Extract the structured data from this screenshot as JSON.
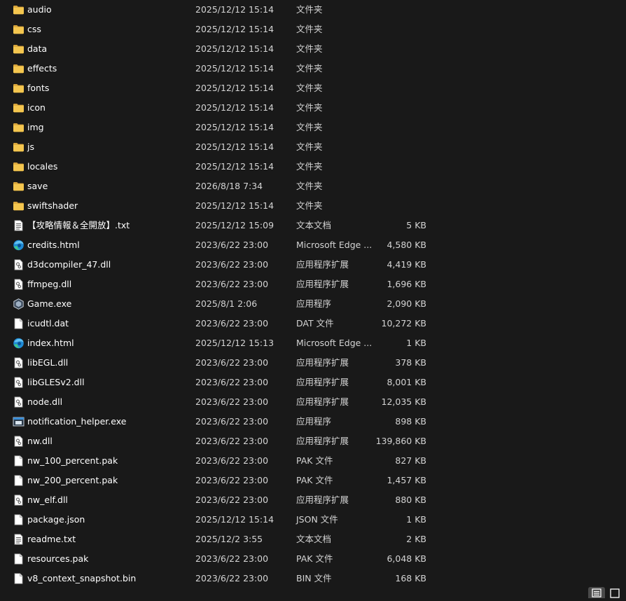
{
  "files": [
    {
      "name": "audio",
      "date": "2025/12/12 15:14",
      "type": "文件夹",
      "size": "",
      "icon": "folder-icon"
    },
    {
      "name": "css",
      "date": "2025/12/12 15:14",
      "type": "文件夹",
      "size": "",
      "icon": "folder-icon"
    },
    {
      "name": "data",
      "date": "2025/12/12 15:14",
      "type": "文件夹",
      "size": "",
      "icon": "folder-icon"
    },
    {
      "name": "effects",
      "date": "2025/12/12 15:14",
      "type": "文件夹",
      "size": "",
      "icon": "folder-icon"
    },
    {
      "name": "fonts",
      "date": "2025/12/12 15:14",
      "type": "文件夹",
      "size": "",
      "icon": "folder-icon"
    },
    {
      "name": "icon",
      "date": "2025/12/12 15:14",
      "type": "文件夹",
      "size": "",
      "icon": "folder-icon"
    },
    {
      "name": "img",
      "date": "2025/12/12 15:14",
      "type": "文件夹",
      "size": "",
      "icon": "folder-icon"
    },
    {
      "name": "js",
      "date": "2025/12/12 15:14",
      "type": "文件夹",
      "size": "",
      "icon": "folder-icon"
    },
    {
      "name": "locales",
      "date": "2025/12/12 15:14",
      "type": "文件夹",
      "size": "",
      "icon": "folder-icon"
    },
    {
      "name": "save",
      "date": "2026/8/18 7:34",
      "type": "文件夹",
      "size": "",
      "icon": "folder-icon"
    },
    {
      "name": "swiftshader",
      "date": "2025/12/12 15:14",
      "type": "文件夹",
      "size": "",
      "icon": "folder-icon"
    },
    {
      "name": "【攻略情報＆全開放】.txt",
      "date": "2025/12/12 15:09",
      "type": "文本文档",
      "size": "5 KB",
      "icon": "text-document-icon"
    },
    {
      "name": "credits.html",
      "date": "2023/6/22 23:00",
      "type": "Microsoft Edge ...",
      "size": "4,580 KB",
      "icon": "edge-browser-icon"
    },
    {
      "name": "d3dcompiler_47.dll",
      "date": "2023/6/22 23:00",
      "type": "应用程序扩展",
      "size": "4,419 KB",
      "icon": "dll-file-icon"
    },
    {
      "name": "ffmpeg.dll",
      "date": "2023/6/22 23:00",
      "type": "应用程序扩展",
      "size": "1,696 KB",
      "icon": "dll-file-icon"
    },
    {
      "name": "Game.exe",
      "date": "2025/8/1 2:06",
      "type": "应用程序",
      "size": "2,090 KB",
      "icon": "game-app-icon"
    },
    {
      "name": "icudtl.dat",
      "date": "2023/6/22 23:00",
      "type": "DAT 文件",
      "size": "10,272 KB",
      "icon": "blank-file-icon"
    },
    {
      "name": "index.html",
      "date": "2025/12/12 15:13",
      "type": "Microsoft Edge ...",
      "size": "1 KB",
      "icon": "edge-browser-icon"
    },
    {
      "name": "libEGL.dll",
      "date": "2023/6/22 23:00",
      "type": "应用程序扩展",
      "size": "378 KB",
      "icon": "dll-file-icon"
    },
    {
      "name": "libGLESv2.dll",
      "date": "2023/6/22 23:00",
      "type": "应用程序扩展",
      "size": "8,001 KB",
      "icon": "dll-file-icon"
    },
    {
      "name": "node.dll",
      "date": "2023/6/22 23:00",
      "type": "应用程序扩展",
      "size": "12,035 KB",
      "icon": "dll-file-icon"
    },
    {
      "name": "notification_helper.exe",
      "date": "2023/6/22 23:00",
      "type": "应用程序",
      "size": "898 KB",
      "icon": "exe-window-icon"
    },
    {
      "name": "nw.dll",
      "date": "2023/6/22 23:00",
      "type": "应用程序扩展",
      "size": "139,860 KB",
      "icon": "dll-file-icon"
    },
    {
      "name": "nw_100_percent.pak",
      "date": "2023/6/22 23:00",
      "type": "PAK 文件",
      "size": "827 KB",
      "icon": "blank-file-icon"
    },
    {
      "name": "nw_200_percent.pak",
      "date": "2023/6/22 23:00",
      "type": "PAK 文件",
      "size": "1,457 KB",
      "icon": "blank-file-icon"
    },
    {
      "name": "nw_elf.dll",
      "date": "2023/6/22 23:00",
      "type": "应用程序扩展",
      "size": "880 KB",
      "icon": "dll-file-icon"
    },
    {
      "name": "package.json",
      "date": "2025/12/12 15:14",
      "type": "JSON 文件",
      "size": "1 KB",
      "icon": "blank-file-icon"
    },
    {
      "name": "readme.txt",
      "date": "2025/12/2 3:55",
      "type": "文本文档",
      "size": "2 KB",
      "icon": "text-document-icon"
    },
    {
      "name": "resources.pak",
      "date": "2023/6/22 23:00",
      "type": "PAK 文件",
      "size": "6,048 KB",
      "icon": "blank-file-icon"
    },
    {
      "name": "v8_context_snapshot.bin",
      "date": "2023/6/22 23:00",
      "type": "BIN 文件",
      "size": "168 KB",
      "icon": "blank-file-icon"
    }
  ],
  "view_buttons": {
    "details_selected": true,
    "details_icon": "details-view-icon",
    "tiles_icon": "large-icons-view-icon"
  },
  "colors": {
    "background": "#191919",
    "folder": "#f4c64f",
    "text": "#ffffff",
    "secondary_text": "#d4d4d4",
    "edge_blue": "#1e8ad6",
    "edge_green": "#3fc88a"
  }
}
